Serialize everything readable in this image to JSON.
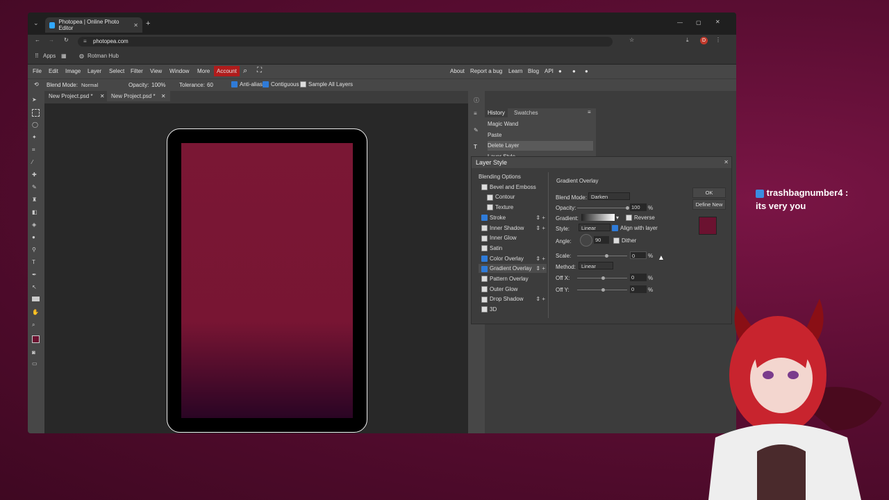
{
  "browser": {
    "tab_title": "Photopea | Online Photo Editor",
    "url": "photopea.com",
    "bookmarks": [
      "Apps",
      "Rotman Hub"
    ],
    "profile_initial": "D"
  },
  "menu": {
    "items": [
      "File",
      "Edit",
      "Image",
      "Layer",
      "Select",
      "Filter",
      "View",
      "Window",
      "More",
      "Account"
    ],
    "right": [
      "About",
      "Report a bug",
      "Learn",
      "Blog",
      "API"
    ]
  },
  "options": {
    "blend_label": "Blend Mode:",
    "blend_value": "Normal",
    "opacity_label": "Opacity:",
    "opacity_value": "100%",
    "tolerance_label": "Tolerance:",
    "tolerance_value": "60",
    "antialias": "Anti-alias",
    "contiguous": "Contiguous",
    "sample_all": "Sample All Layers"
  },
  "doc_tabs": [
    "New Project.psd *",
    "New Project.psd *"
  ],
  "panel_tabs": [
    "History",
    "Swatches"
  ],
  "history": [
    "Magic Wand",
    "Paste",
    "Delete Layer",
    "Layer Style"
  ],
  "dialog": {
    "title": "Layer Style",
    "section": "Gradient Overlay",
    "options": [
      {
        "label": "Blending Options",
        "check": null,
        "plus": false
      },
      {
        "label": "Bevel and Emboss",
        "check": false,
        "plus": false
      },
      {
        "label": "Contour",
        "check": false,
        "plus": false
      },
      {
        "label": "Texture",
        "check": false,
        "plus": false
      },
      {
        "label": "Stroke",
        "check": true,
        "plus": true
      },
      {
        "label": "Inner Shadow",
        "check": false,
        "plus": true
      },
      {
        "label": "Inner Glow",
        "check": false,
        "plus": false
      },
      {
        "label": "Satin",
        "check": false,
        "plus": false
      },
      {
        "label": "Color Overlay",
        "check": true,
        "plus": true
      },
      {
        "label": "Gradient Overlay",
        "check": true,
        "plus": true
      },
      {
        "label": "Pattern Overlay",
        "check": false,
        "plus": false
      },
      {
        "label": "Outer Glow",
        "check": false,
        "plus": false
      },
      {
        "label": "Drop Shadow",
        "check": false,
        "plus": true
      },
      {
        "label": "3D",
        "check": false,
        "plus": false
      }
    ],
    "blend_mode_label": "Blend Mode:",
    "blend_mode_value": "Darken",
    "opacity_label": "Opacity:",
    "opacity_value": "100",
    "gradient_label": "Gradient:",
    "reverse_label": "Reverse",
    "style_label": "Style:",
    "style_value": "Linear",
    "align_label": "Align with layer",
    "angle_label": "Angle:",
    "angle_value": "90",
    "dither_label": "Dither",
    "scale_label": "Scale:",
    "scale_value": "0",
    "method_label": "Method:",
    "method_value": "Linear",
    "offx_label": "Off X:",
    "offx_value": "0",
    "offy_label": "Off Y:",
    "offy_value": "0",
    "percent": "%",
    "ok_label": "OK",
    "define_new_label": "Define New",
    "swatch_color": "#6b1230"
  },
  "chat": {
    "username": "trashbagnumber4 :",
    "message": "its very you"
  }
}
